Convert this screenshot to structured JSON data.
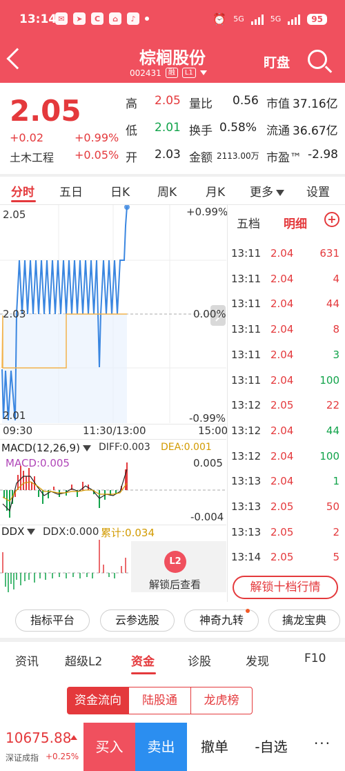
{
  "status_bar": {
    "time": "13:14",
    "battery": "95",
    "net1": "5G",
    "net2": "5G"
  },
  "header": {
    "title": "棕榈股份",
    "code": "002431",
    "tag_margin": "融",
    "tag_level": "L1",
    "watch_label": "盯盘"
  },
  "quote": {
    "price": "2.05",
    "change": "+0.02",
    "change_pct": "+0.99%",
    "sector": "土木工程",
    "sector_pct": "+0.05%",
    "high_label": "高",
    "high": "2.05",
    "low_label": "低",
    "low": "2.01",
    "open_label": "开",
    "open": "2.03",
    "vol_ratio_label": "量比",
    "vol_ratio": "0.56",
    "turnover_label": "换手",
    "turnover": "0.58%",
    "amount_label": "金额",
    "amount": "2113.00万",
    "mktcap_label": "市值",
    "mktcap": "37.16亿",
    "float_label": "流通",
    "float_cap": "36.67亿",
    "pe_label": "市盈™",
    "pe": "-2.98"
  },
  "chart_tabs": [
    "分时",
    "五日",
    "日K",
    "周K",
    "月K",
    "更多",
    "设置"
  ],
  "chart_labels": {
    "y_top": "2.05",
    "y_mid": "2.03",
    "y_bot": "2.01",
    "pct_top": "+0.99%",
    "pct_mid": "0.00%",
    "pct_bot": "-0.99%",
    "t_start": "09:30",
    "t_mid": "11:30/13:00",
    "t_end": "15:00"
  },
  "macd": {
    "name": "MACD(12,26,9)",
    "diff": "DIFF:0.003",
    "dea": "DEA:0.001",
    "macd": "MACD:0.005",
    "max": "0.005",
    "min": "-0.004"
  },
  "ddx": {
    "name": "DDX",
    "ddx": "DDX:0.000",
    "cum": "累计:0.034",
    "lock_badge": "L2",
    "lock_text": "解锁后查看"
  },
  "right_panel": {
    "tab1": "五档",
    "tab2": "明细",
    "ticks": [
      {
        "time": "13:11",
        "price": "2.04",
        "vol": "631",
        "dir": "red"
      },
      {
        "time": "13:11",
        "price": "2.04",
        "vol": "4",
        "dir": "red"
      },
      {
        "time": "13:11",
        "price": "2.04",
        "vol": "44",
        "dir": "red"
      },
      {
        "time": "13:11",
        "price": "2.04",
        "vol": "8",
        "dir": "red"
      },
      {
        "time": "13:11",
        "price": "2.04",
        "vol": "3",
        "dir": "green"
      },
      {
        "time": "13:11",
        "price": "2.04",
        "vol": "100",
        "dir": "green"
      },
      {
        "time": "13:12",
        "price": "2.05",
        "vol": "22",
        "dir": "red"
      },
      {
        "time": "13:12",
        "price": "2.04",
        "vol": "44",
        "dir": "green"
      },
      {
        "time": "13:12",
        "price": "2.04",
        "vol": "100",
        "dir": "green"
      },
      {
        "time": "13:13",
        "price": "2.04",
        "vol": "1",
        "dir": "green"
      },
      {
        "time": "13:13",
        "price": "2.05",
        "vol": "50",
        "dir": "red"
      },
      {
        "time": "13:13",
        "price": "2.05",
        "vol": "2",
        "dir": "red"
      },
      {
        "time": "13:14",
        "price": "2.05",
        "vol": "5",
        "dir": "red"
      }
    ],
    "unlock_label": "解锁十档行情"
  },
  "tools": [
    "指标平台",
    "云参选股",
    "神奇九转",
    "擒龙宝典"
  ],
  "nav_tabs": [
    "资讯",
    "超级L2",
    "资金",
    "诊股",
    "发现",
    "F10"
  ],
  "segments": [
    "资金流向",
    "陆股通",
    "龙虎榜"
  ],
  "bottom": {
    "index_value": "10675.88",
    "index_name": "深证成指",
    "index_pct": "+0.25%",
    "buy": "买入",
    "sell": "卖出",
    "cancel": "撤单",
    "fav": "-自选",
    "more": "···"
  },
  "colors": {
    "header": "#f0505e",
    "up": "#e4393c",
    "down": "#11a34a",
    "line": "#3a86e0",
    "avg": "#f2b24a"
  }
}
